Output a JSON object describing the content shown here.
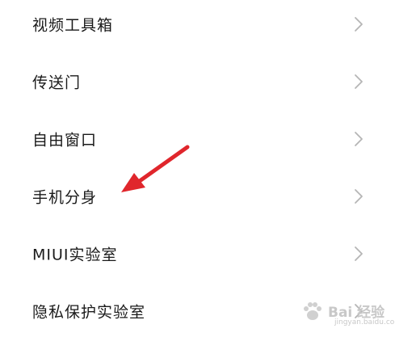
{
  "settings_list": {
    "items": [
      {
        "label": "视频工具箱"
      },
      {
        "label": "传送门"
      },
      {
        "label": "自由窗口"
      },
      {
        "label": "手机分身"
      },
      {
        "label": "MIUI实验室"
      },
      {
        "label": "隐私保护实验室"
      }
    ]
  },
  "annotation": {
    "arrow_color": "#e0262c"
  },
  "watermark": {
    "text": "Bai 经验",
    "sub": "jingyan.baidu.com"
  }
}
